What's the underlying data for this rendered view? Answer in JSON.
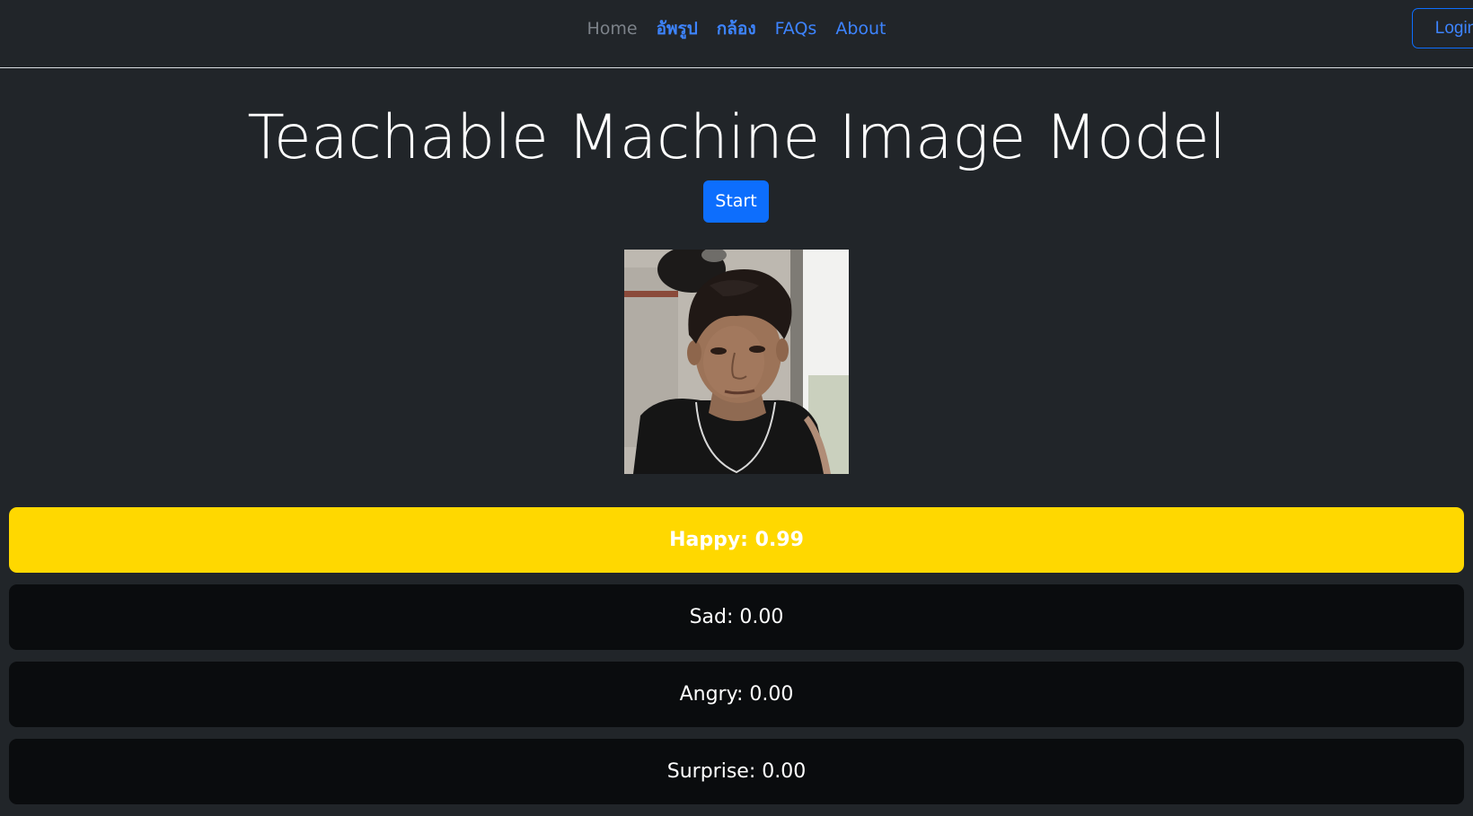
{
  "nav": {
    "items": [
      {
        "label": "Home",
        "active": true
      },
      {
        "label": "อัพรูป",
        "active": false
      },
      {
        "label": "กล้อง",
        "active": false
      },
      {
        "label": "FAQs",
        "active": false
      },
      {
        "label": "About",
        "active": false
      }
    ],
    "login_label": "Login"
  },
  "main": {
    "title": "Teachable Machine Image Model",
    "start_label": "Start",
    "webcam_icon": "webcam-feed"
  },
  "predictions": [
    {
      "label": "Happy: 0.99",
      "class": "Happy",
      "probability": 0.99
    },
    {
      "label": "Sad: 0.00",
      "class": "Sad",
      "probability": 0.0
    },
    {
      "label": "Angry: 0.00",
      "class": "Angry",
      "probability": 0.0
    },
    {
      "label": "Surprise: 0.00",
      "class": "Surprise",
      "probability": 0.0
    }
  ],
  "colors": {
    "background": "#212529",
    "accent": "#0d6efd",
    "top_prediction": "#ffd800",
    "prediction_row": "#0a0c0e"
  }
}
